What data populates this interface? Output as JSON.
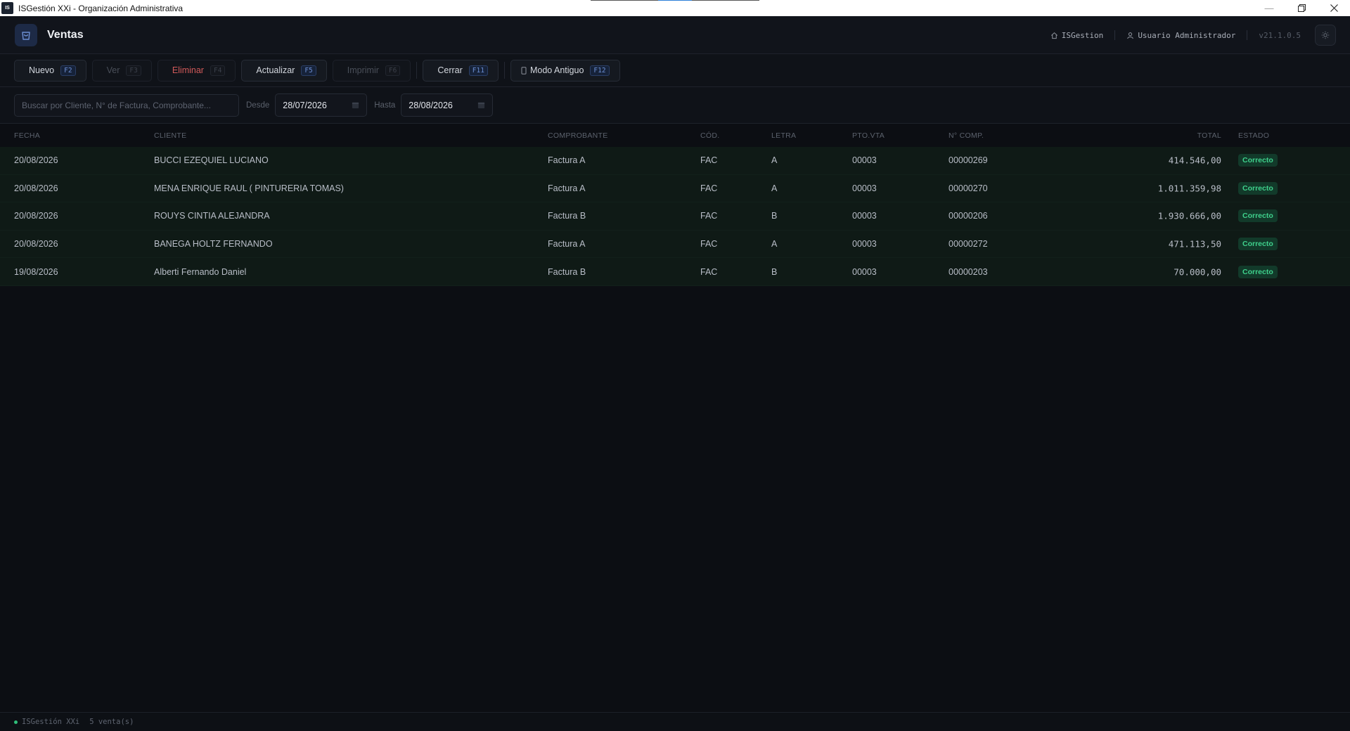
{
  "window": {
    "icon_text": "IS",
    "title": "ISGestión XXi - Organización Administrativa"
  },
  "header": {
    "module_title": "Ventas",
    "company": "ISGestion",
    "user": "Usuario Administrador",
    "version": "v21.1.0.5"
  },
  "toolbar": {
    "buttons": [
      {
        "label": "Nuevo",
        "key": "F2"
      },
      {
        "label": "Ver",
        "key": "F3"
      },
      {
        "label": "Eliminar",
        "key": "F4"
      },
      {
        "label": "Actualizar",
        "key": "F5"
      },
      {
        "label": "Imprimir",
        "key": "F6"
      },
      {
        "label": "Cerrar",
        "key": "F11"
      },
      {
        "label": "Modo Antiguo",
        "key": "F12"
      }
    ]
  },
  "filters": {
    "search_placeholder": "Buscar por Cliente, N° de Factura, Comprobante...",
    "desde_label": "Desde",
    "desde_value": "28/07/2026",
    "hasta_label": "Hasta",
    "hasta_value": "28/08/2026"
  },
  "table": {
    "columns": [
      "FECHA",
      "CLIENTE",
      "COMPROBANTE",
      "CÓD.",
      "LETRA",
      "PTO.VTA",
      "N° COMP.",
      "TOTAL",
      "ESTADO"
    ],
    "rows": [
      {
        "fecha": "20/08/2026",
        "cliente": "BUCCI EZEQUIEL LUCIANO",
        "comprobante": "Factura A",
        "cod": "FAC",
        "letra": "A",
        "pto": "00003",
        "ncomp": "00000269",
        "total": "414.546,00",
        "estado": "Correcto"
      },
      {
        "fecha": "20/08/2026",
        "cliente": "MENA ENRIQUE RAUL ( PINTURERIA TOMAS)",
        "comprobante": "Factura A",
        "cod": "FAC",
        "letra": "A",
        "pto": "00003",
        "ncomp": "00000270",
        "total": "1.011.359,98",
        "estado": "Correcto"
      },
      {
        "fecha": "20/08/2026",
        "cliente": "ROUYS CINTIA ALEJANDRA",
        "comprobante": "Factura B",
        "cod": "FAC",
        "letra": "B",
        "pto": "00003",
        "ncomp": "00000206",
        "total": "1.930.666,00",
        "estado": "Correcto"
      },
      {
        "fecha": "20/08/2026",
        "cliente": "BANEGA HOLTZ FERNANDO",
        "comprobante": "Factura A",
        "cod": "FAC",
        "letra": "A",
        "pto": "00003",
        "ncomp": "00000272",
        "total": "471.113,50",
        "estado": "Correcto"
      },
      {
        "fecha": "19/08/2026",
        "cliente": "Alberti Fernando Daniel",
        "comprobante": "Factura B",
        "cod": "FAC",
        "letra": "B",
        "pto": "00003",
        "ncomp": "00000203",
        "total": "70.000,00",
        "estado": "Correcto"
      }
    ]
  },
  "statusbar": {
    "app": "ISGestión XXi",
    "count": "5 venta(s)"
  },
  "colors": {
    "accent": "#6c8fd3",
    "success": "#3fd18c",
    "danger": "#d25a5a",
    "row_bg": "#0f1a16"
  }
}
